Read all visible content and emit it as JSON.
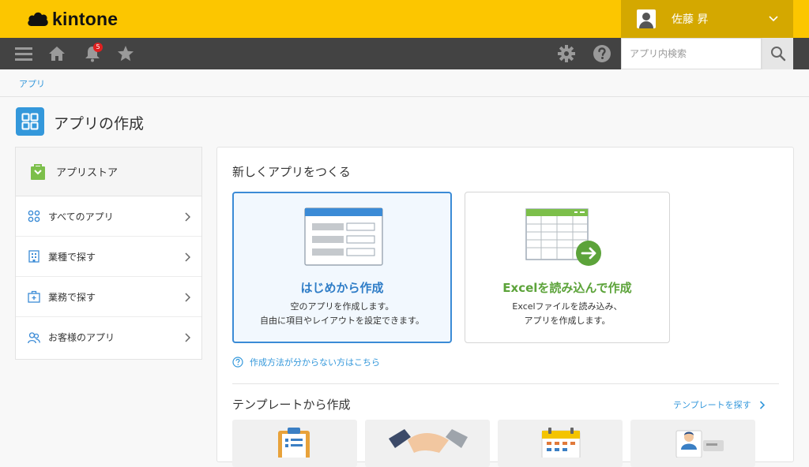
{
  "header": {
    "brand": "kintone",
    "user_name": "佐藤 昇"
  },
  "navbar": {
    "notification_count": "5",
    "search_placeholder": "アプリ内検索"
  },
  "breadcrumb": "アプリ",
  "page_title": "アプリの作成",
  "sidebar": {
    "store_label": "アプリストア",
    "items": [
      {
        "label": "すべてのアプリ",
        "icon": "grid-icon"
      },
      {
        "label": "業種で探す",
        "icon": "building-icon"
      },
      {
        "label": "業務で探す",
        "icon": "briefcase-icon"
      },
      {
        "label": "お客様のアプリ",
        "icon": "users-icon"
      }
    ]
  },
  "create_section": {
    "title": "新しくアプリをつくる",
    "scratch": {
      "title": "はじめから作成",
      "desc_line1": "空のアプリを作成します。",
      "desc_line2": "自由に項目やレイアウトを設定できます。"
    },
    "excel": {
      "title": "Excelを読み込んで作成",
      "desc_line1": "Excelファイルを読み込み、",
      "desc_line2": "アプリを作成します。"
    },
    "help_link": "作成方法が分からない方はこちら"
  },
  "template_section": {
    "title": "テンプレートから作成",
    "browse_link": "テンプレートを探す"
  },
  "colors": {
    "header_yellow": "#fcc600",
    "navbar": "#434343",
    "accent_blue": "#3498db",
    "excel_green": "#5ca33a"
  }
}
